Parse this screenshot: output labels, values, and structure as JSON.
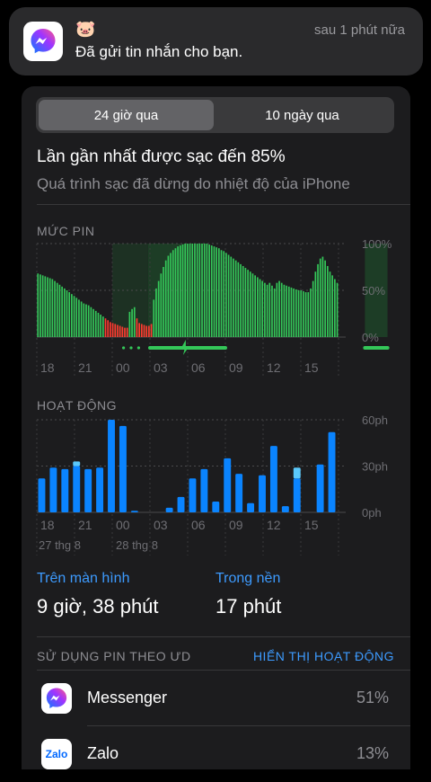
{
  "notification": {
    "app": "Messenger",
    "icon": "messenger-icon",
    "sender": "🐷",
    "message": "Đã gửi tin nhắn cho bạn.",
    "time": "sau 1 phút nữa"
  },
  "segment": {
    "options": [
      "24 giờ qua",
      "10 ngày qua"
    ],
    "selected": "24 giờ qua"
  },
  "charge": {
    "title": "Lần gần nhất được sạc đến 85%",
    "subtitle": "Quá trình sạc đã dừng do nhiệt độ của iPhone"
  },
  "battery": {
    "label": "MỨC PIN",
    "y_ticks": [
      "100%",
      "50%",
      "0%"
    ],
    "x_ticks": [
      "18",
      "21",
      "00",
      "03",
      "06",
      "09",
      "12",
      "15"
    ]
  },
  "activity": {
    "label": "HOẠT ĐỘNG",
    "y_ticks": [
      "60ph",
      "30ph",
      "0ph"
    ],
    "x_ticks": [
      "18",
      "21",
      "00",
      "03",
      "06",
      "09",
      "12",
      "15"
    ],
    "dates": [
      "27 thg 8",
      "28 thg 8"
    ]
  },
  "stats": {
    "screen_label": "Trên màn hình",
    "screen_value": "9 giờ, 38 phút",
    "background_label": "Trong nền",
    "background_value": "17 phút"
  },
  "usage": {
    "header": "SỬ DỤNG PIN THEO ƯD",
    "link": "HIỂN THỊ HOẠT ĐỘNG",
    "apps": [
      {
        "name": "Messenger",
        "percent": "51%",
        "icon": "messenger-icon"
      },
      {
        "name": "Zalo",
        "percent": "13%",
        "icon": "zalo-icon",
        "icon_text": "Zalo"
      }
    ]
  },
  "colors": {
    "battery_green": "#34c759",
    "battery_red": "#ff3b30",
    "charging_band": "#1f5a2e",
    "activity_blue": "#0a84ff",
    "activity_light": "#5ac8fa",
    "link_blue": "#3d9bff"
  },
  "chart_data": [
    {
      "type": "bar",
      "title": "MỨC PIN",
      "x_ticks": [
        "18",
        "21",
        "00",
        "03",
        "06",
        "09",
        "12",
        "15"
      ],
      "y_ticks": [
        "100%",
        "50%",
        "0%"
      ],
      "ylim": [
        0,
        100
      ],
      "series": [
        {
          "values": [
            68,
            67,
            66,
            65,
            64,
            63,
            62,
            60,
            58,
            56,
            54,
            52,
            50,
            48,
            46,
            44,
            42,
            40,
            38,
            36,
            35,
            34,
            32,
            30,
            28,
            26,
            24,
            22,
            20,
            18,
            16,
            15,
            14,
            13,
            12,
            11,
            10,
            10,
            27,
            30,
            32,
            20,
            15,
            14,
            13,
            12,
            12,
            14,
            40,
            52,
            60,
            68,
            75,
            82,
            87,
            90,
            93,
            95,
            97,
            98,
            99,
            100,
            100,
            100,
            100,
            100,
            100,
            100,
            100,
            100,
            100,
            99,
            98,
            97,
            96,
            95,
            93,
            92,
            90,
            88,
            86,
            84,
            82,
            80,
            78,
            76,
            74,
            72,
            70,
            68,
            66,
            64,
            62,
            60,
            58,
            56,
            58,
            55,
            52,
            58,
            60,
            58,
            56,
            55,
            54,
            53,
            52,
            51,
            50,
            50,
            49,
            48,
            48,
            52,
            60,
            70,
            78,
            84,
            86,
            82,
            76,
            70,
            66,
            62,
            58
          ]
        }
      ],
      "low_battery_range_hours": [
        "21",
        "00"
      ],
      "charging_ranges_hours": [
        [
          "00",
          "03"
        ],
        [
          "09",
          "10"
        ],
        [
          "13",
          "14"
        ]
      ]
    },
    {
      "type": "bar",
      "title": "HOẠT ĐỘNG",
      "x_ticks": [
        "18",
        "21",
        "00",
        "03",
        "06",
        "09",
        "12",
        "15"
      ],
      "y_ticks": [
        "60ph",
        "30ph",
        "0ph"
      ],
      "ylim": [
        0,
        60
      ],
      "series": [
        {
          "name": "Trên màn hình",
          "values": [
            22,
            29,
            28,
            30,
            28,
            29,
            60,
            56,
            1,
            0,
            0,
            3,
            10,
            22,
            28,
            7,
            35,
            25,
            6,
            24,
            43,
            4,
            22,
            0,
            31,
            52
          ]
        },
        {
          "name": "Trong nền",
          "values": [
            0,
            0,
            0,
            3,
            0,
            0,
            0,
            0,
            0,
            0,
            0,
            0,
            0,
            0,
            0,
            0,
            0,
            0,
            0,
            0,
            0,
            0,
            7,
            0,
            0,
            0
          ]
        }
      ],
      "dates": [
        "27 thg 8",
        "28 thg 8"
      ]
    }
  ]
}
